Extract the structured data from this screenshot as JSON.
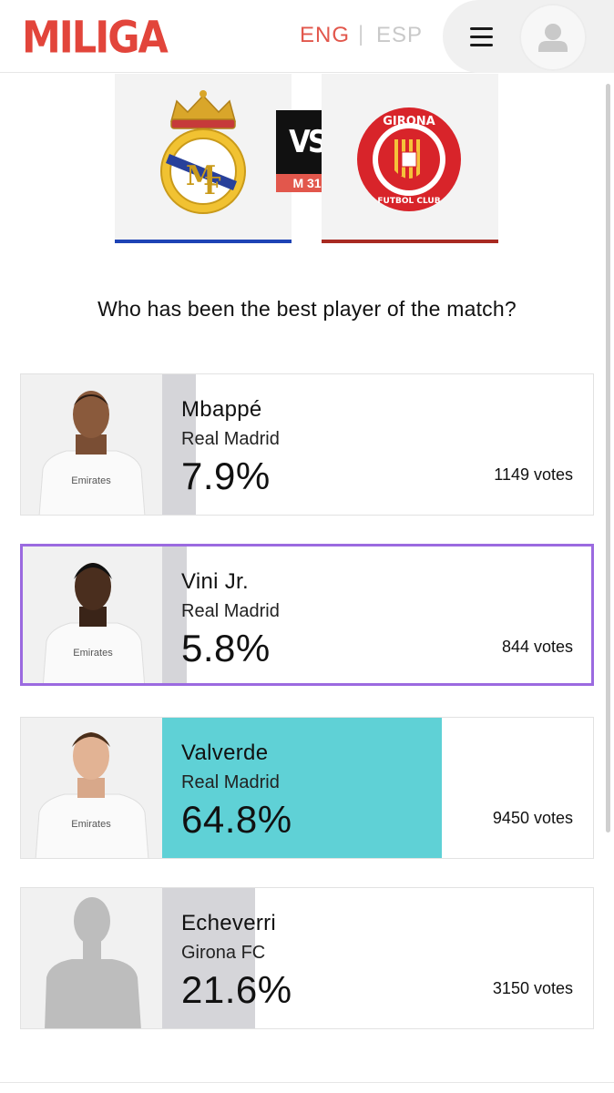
{
  "header": {
    "logo": "MILIGA",
    "lang_active": "ENG",
    "lang_separator": "|",
    "lang_inactive": "ESP",
    "menu_icon": "hamburger-icon",
    "user_icon": "user-icon"
  },
  "match": {
    "home_team_crest": "real-madrid-crest-icon",
    "away_team_crest": "girona-crest-icon",
    "away_crest_text_top": "GIRONA",
    "away_crest_text_bottom": "FUTBOL CLUB",
    "vs_label": "VS",
    "matchday": "M 31",
    "home_color": "#1e43b5",
    "away_color": "#a82a22"
  },
  "question": "Who has been the best player of the match?",
  "players": [
    {
      "name": "Mbappé",
      "team": "Real Madrid",
      "percent": "7.9%",
      "votes": "1149 votes",
      "share": 7.9,
      "selected": false
    },
    {
      "name": "Vini Jr.",
      "team": "Real Madrid",
      "percent": "5.8%",
      "votes": "844 votes",
      "share": 5.8,
      "selected": true
    },
    {
      "name": "Valverde",
      "team": "Real Madrid",
      "percent": "64.8%",
      "votes": "9450 votes",
      "share": 64.8,
      "selected": false
    },
    {
      "name": "Echeverri",
      "team": "Girona FC",
      "percent": "21.6%",
      "votes": "3150 votes",
      "share": 21.6,
      "selected": false
    }
  ],
  "colors": {
    "accent": "#e2453b",
    "winner_bar": "#5fd1d6",
    "default_bar": "#d5d5d9",
    "selected_border": "#9b6ae0"
  }
}
